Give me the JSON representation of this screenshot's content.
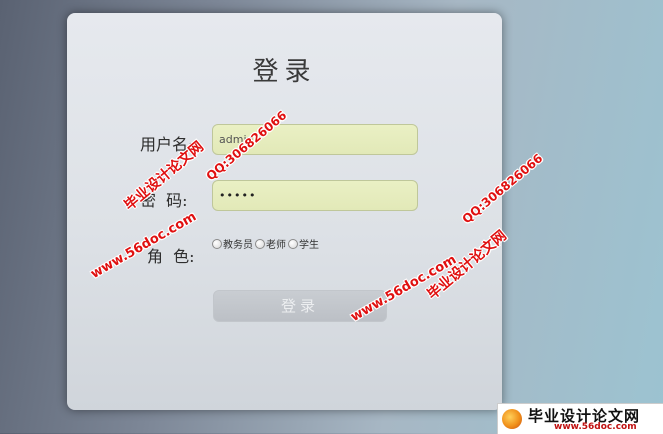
{
  "login": {
    "title": "登录",
    "username_label": "用户名:",
    "username_value": "admin",
    "password_label": "密  码:",
    "password_value": "•••••",
    "role_label": "角  色:",
    "roles": [
      "教务员",
      "老师",
      "学生"
    ],
    "submit_label": "登录"
  },
  "watermarks": {
    "site": "www.56doc.com",
    "qq": "QQ:306826066",
    "brand": "毕业设计论文网"
  },
  "logo": {
    "title": "毕业设计论文网",
    "url": "www.56doc.com"
  }
}
